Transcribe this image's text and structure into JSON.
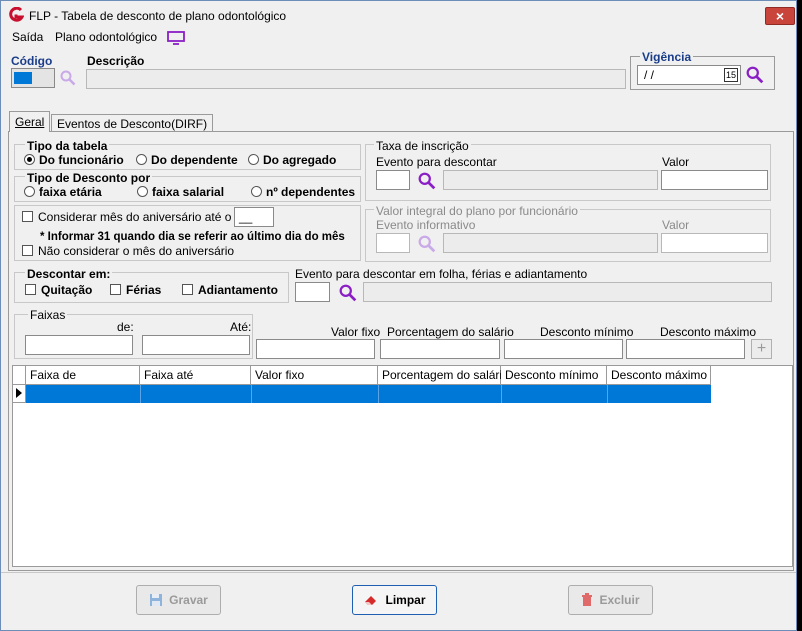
{
  "window": {
    "title": "FLP - Tabela de desconto de plano odontológico",
    "close_label": "×"
  },
  "menu": {
    "saida": "Saída",
    "plano": "Plano odontológico"
  },
  "header": {
    "codigo_label": "Código",
    "descricao_label": "Descrição",
    "vigencia_label": "Vigência",
    "vigencia_value": "/ /",
    "calendar_day": "15"
  },
  "tabs": [
    {
      "label": "Geral"
    },
    {
      "label": "Eventos de Desconto(DIRF)"
    }
  ],
  "tipo_tabela": {
    "label": "Tipo da tabela",
    "options": [
      "Do funcionário",
      "Do dependente",
      "Do agregado"
    ],
    "selected": "Do funcionário"
  },
  "tipo_desconto": {
    "label": "Tipo de Desconto por",
    "options": [
      "faixa etária",
      "faixa salarial",
      "nº dependentes"
    ]
  },
  "aniversario": {
    "considerar_label": "Considerar mês do aniversário até o dia",
    "dia_value": "__",
    "info": "* Informar 31 quando dia se referir ao último dia do mês",
    "nao_considerar_label": "Não considerar o mês do aniversário"
  },
  "taxa_inscricao": {
    "label": "Taxa de inscrição",
    "evento_label": "Evento para descontar",
    "valor_label": "Valor"
  },
  "valor_integral": {
    "label": "Valor integral do plano por funcionário",
    "evento_label": "Evento informativo",
    "valor_label": "Valor"
  },
  "descontar_em": {
    "label": "Descontar em:",
    "options": [
      "Quitação",
      "Férias",
      "Adiantamento"
    ]
  },
  "evento_folha": {
    "label": "Evento para descontar em folha, férias e adiantamento"
  },
  "faixas": {
    "label": "Faixas",
    "de_label": "de:",
    "ate_label": "Até:",
    "valor_fixo_label": "Valor fixo",
    "porcentagem_label": "Porcentagem do salário",
    "desc_min_label": "Desconto mínimo",
    "desc_max_label": "Desconto máximo"
  },
  "grid": {
    "columns": [
      "Faixa de",
      "Faixa até",
      "Valor fixo",
      "Porcentagem do salário",
      "Desconto mínimo",
      "Desconto máximo"
    ]
  },
  "buttons": {
    "gravar": "Gravar",
    "limpar": "Limpar",
    "excluir": "Excluir"
  },
  "colors": {
    "accent": "#8b1fc6",
    "selection": "#0078d7",
    "brand": "#c8102e"
  }
}
